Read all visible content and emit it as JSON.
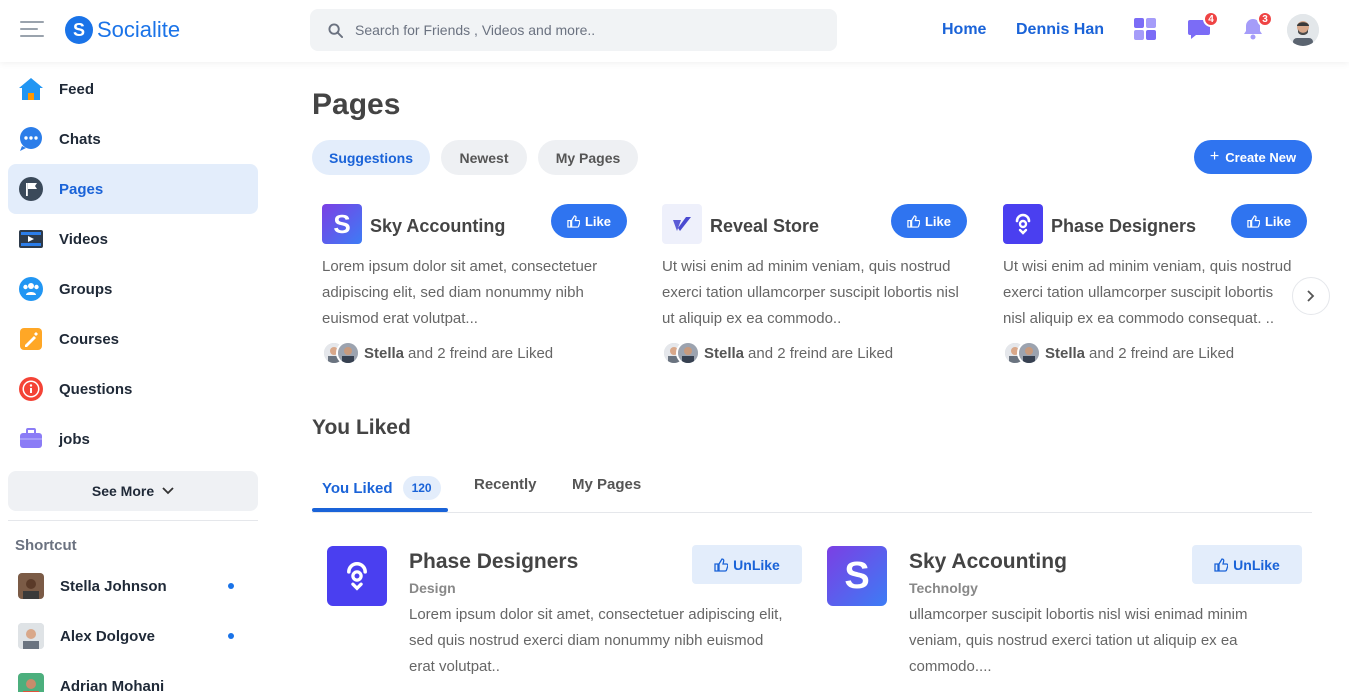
{
  "app": {
    "name": "Socialite",
    "logo_letter": "S"
  },
  "header": {
    "search_placeholder": "Search for Friends , Videos and more..",
    "nav": {
      "home": "Home",
      "user": "Dennis Han"
    },
    "messages_badge": "4",
    "notifications_badge": "3"
  },
  "sidebar": {
    "items": [
      {
        "label": "Feed",
        "icon": "home-icon"
      },
      {
        "label": "Chats",
        "icon": "chat-icon"
      },
      {
        "label": "Pages",
        "icon": "flag-icon",
        "active": true
      },
      {
        "label": "Videos",
        "icon": "video-icon"
      },
      {
        "label": "Groups",
        "icon": "groups-icon"
      },
      {
        "label": "Courses",
        "icon": "courses-icon"
      },
      {
        "label": "Questions",
        "icon": "info-icon"
      },
      {
        "label": "jobs",
        "icon": "briefcase-icon"
      }
    ],
    "see_more": "See More",
    "shortcut_title": "Shortcut",
    "shortcuts": [
      {
        "name": "Stella Johnson",
        "online": true
      },
      {
        "name": "Alex Dolgove",
        "online": true
      },
      {
        "name": "Adrian Mohani",
        "online": false
      }
    ]
  },
  "main": {
    "title": "Pages",
    "filters": [
      "Suggestions",
      "Newest",
      "My Pages"
    ],
    "active_filter": "Suggestions",
    "create_button": "Create New",
    "suggestions": [
      {
        "name": "Sky Accounting",
        "logo": "S",
        "like_label": "Like",
        "description": "Lorem ipsum dolor sit amet, consectetuer adipiscing elit, sed diam nonummy nibh euismod erat volutpat...",
        "liked_by": "Stella",
        "liked_suffix": "and 2 freind are Liked"
      },
      {
        "name": "Reveal Store",
        "logo": "reveal",
        "like_label": "Like",
        "description": "Ut wisi enim ad minim veniam, quis nostrud exerci tation ullamcorper suscipit lobortis nisl ut aliquip ex ea commodo..",
        "liked_by": "Stella",
        "liked_suffix": "and 2 freind are Liked"
      },
      {
        "name": "Phase Designers",
        "logo": "phase",
        "like_label": "Like",
        "description": "Ut wisi enim ad minim veniam, quis nostrud exerci tation ullamcorper suscipit lobortis nisl aliquip ex ea commodo consequat. ..",
        "liked_by": "Stella",
        "liked_suffix": "and 2 freind are Liked"
      }
    ],
    "you_liked_title": "You Liked",
    "tabs": [
      {
        "label": "You Liked",
        "count": "120"
      },
      {
        "label": "Recently"
      },
      {
        "label": "My Pages"
      }
    ],
    "liked_pages": [
      {
        "name": "Phase Designers",
        "category": "Design",
        "unlike_label": "UnLike",
        "description": "Lorem ipsum dolor sit amet, consectetuer adipiscing elit, sed quis nostrud exerci diam nonummy nibh euismod erat volutpat.."
      },
      {
        "name": "Sky Accounting",
        "category": "Technolgy",
        "unlike_label": "UnLike",
        "description": "ullamcorper suscipit lobortis nisl wisi enimad minim veniam, quis nostrud exerci tation ut aliquip ex ea commodo...."
      }
    ]
  }
}
